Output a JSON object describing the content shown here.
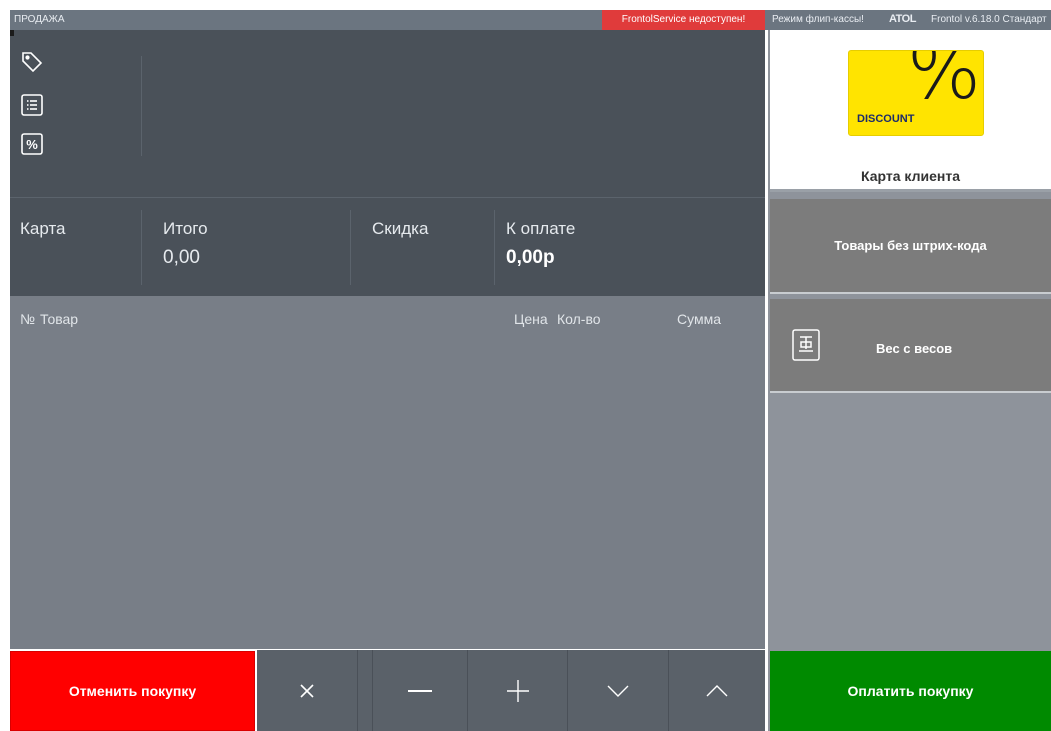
{
  "topbar": {
    "title": "ПРОДАЖА",
    "alert": "FrontolService недоступен!",
    "mode": "Режим флип-кассы!",
    "logo": "ATOL",
    "version": "Frontol v.6.18.0 Стандарт"
  },
  "side_icons": [
    "tag-icon",
    "list-icon",
    "percent-icon"
  ],
  "totals": {
    "card_label": "Карта",
    "total_label": "Итого",
    "total_value": "0,00",
    "discount_label": "Скидка",
    "to_pay_label": "К оплате",
    "to_pay_value": "0,00р"
  },
  "receipt": {
    "columns": {
      "num": "№",
      "item": "Товар",
      "price": "Цена",
      "qty": "Кол-во",
      "sum": "Сумма"
    },
    "rows": []
  },
  "right_panel": {
    "discount_card_text": "DISCOUNT",
    "discount_card_symbol": "%",
    "client_card_label": "Карта клиента",
    "no_barcode_label": "Товары без штрих-кода",
    "weight_label": "Вес с весов"
  },
  "controls": {
    "cancel_label": "Отменить покупку",
    "pay_label": "Оплатить покупку",
    "icons": [
      "close-icon",
      "minus-icon",
      "plus-icon",
      "chevron-down-icon",
      "chevron-up-icon"
    ]
  },
  "colors": {
    "cancel": "#ff0000",
    "pay": "#008a00",
    "alert": "#e03b3b",
    "discount_card": "#ffe400"
  }
}
